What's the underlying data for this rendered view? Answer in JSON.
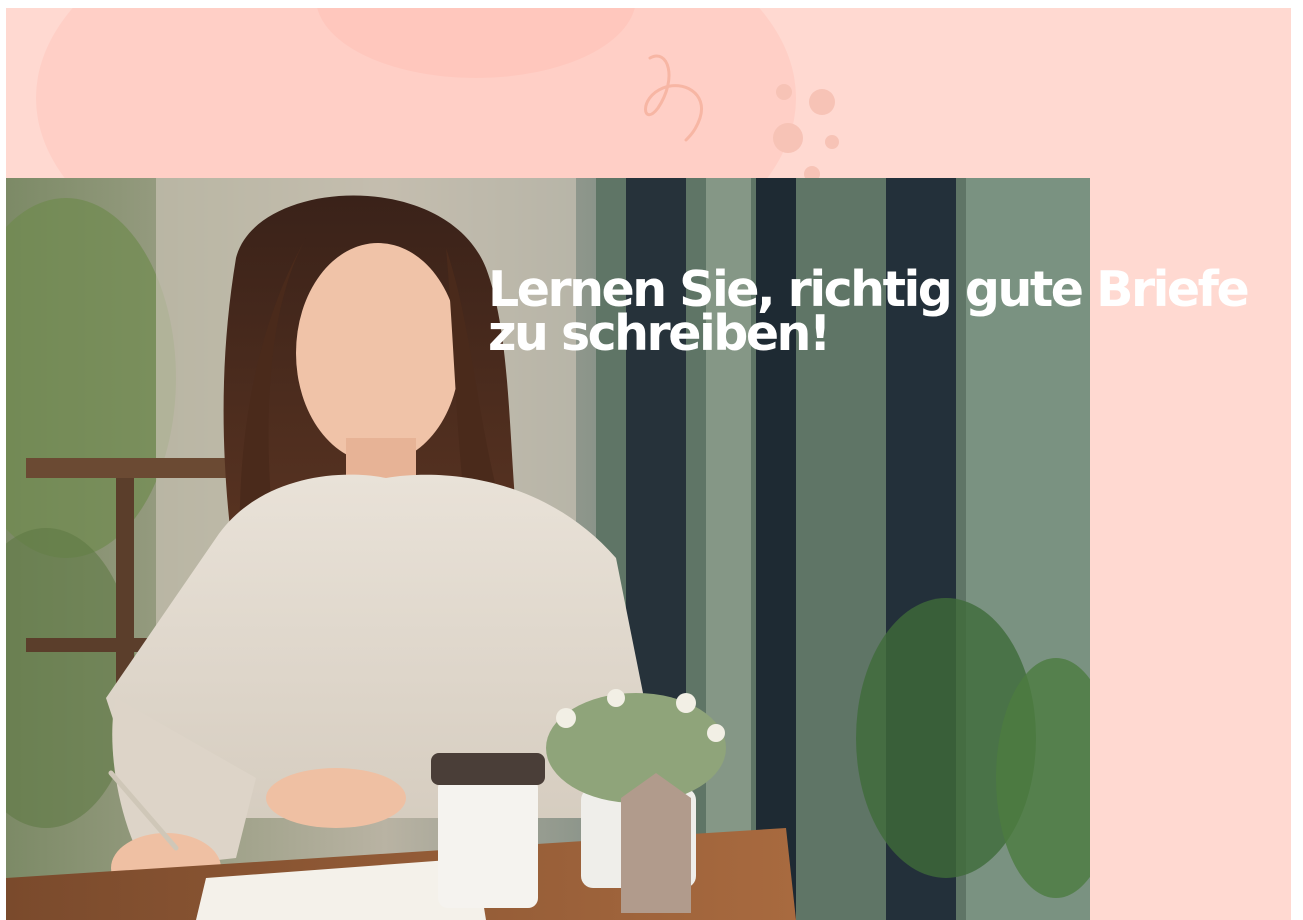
{
  "headline": {
    "line1": "Lernen Sie, richtig gute Briefe",
    "line2": "zu schreiben!"
  },
  "colors": {
    "background": "#ffd9d1",
    "blob": "#ffcfc6",
    "accent": "#f7b6a4",
    "headline": "#ffffff"
  },
  "photo": {
    "subject": "woman-writing-at-cafe-table-photo"
  }
}
